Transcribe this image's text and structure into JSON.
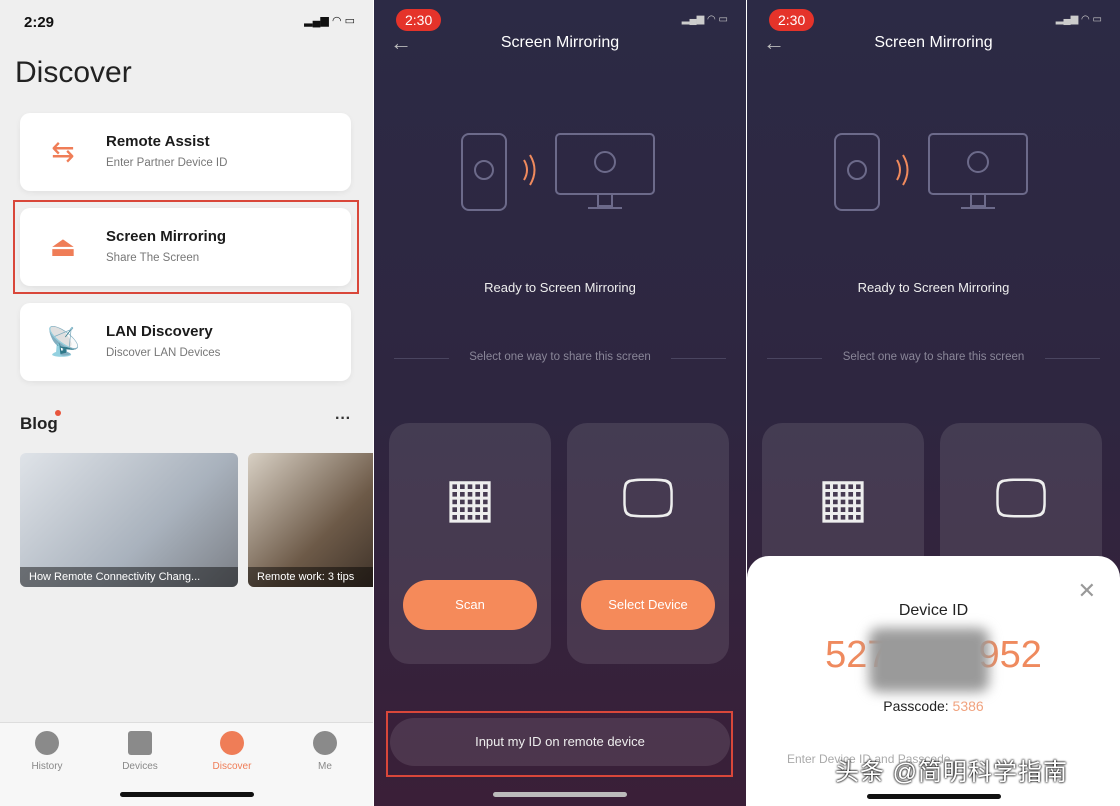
{
  "discover": {
    "status_time": "2:29",
    "title": "Discover",
    "cards": [
      {
        "title": "Remote Assist",
        "subtitle": "Enter Partner Device ID",
        "icon": "arrows-swap-icon"
      },
      {
        "title": "Screen Mirroring",
        "subtitle": "Share The Screen",
        "icon": "airplay-icon"
      },
      {
        "title": "LAN Discovery",
        "subtitle": "Discover LAN Devices",
        "icon": "satellite-dish-icon"
      }
    ],
    "blog_title": "Blog",
    "more": "···",
    "blog_posts": [
      {
        "caption": "How Remote Connectivity Chang..."
      },
      {
        "caption": "Remote work: 3 tips"
      }
    ],
    "tabs": [
      {
        "label": "History"
      },
      {
        "label": "Devices"
      },
      {
        "label": "Discover",
        "active": true
      },
      {
        "label": "Me"
      }
    ]
  },
  "mirroring": {
    "status_time": "2:30",
    "back": "←",
    "title": "Screen Mirroring",
    "ready": "Ready to Screen Mirroring",
    "select_hint": "Select one way to share this screen",
    "scan": "Scan",
    "select_device": "Select Device",
    "input_id": "Input my ID on remote device"
  },
  "sheet": {
    "close": "✕",
    "label": "Device ID",
    "id_start": "527",
    "id_end": "952",
    "passcode_label": "Passcode:",
    "passcode": "5386",
    "enter_hint": "Enter Device ID and Passcode",
    "watermark": "头条 @简明科学指南"
  },
  "colors": {
    "accent": "#ef7d57",
    "highlight": "#d9473a",
    "status_pill": "#e5332a"
  }
}
